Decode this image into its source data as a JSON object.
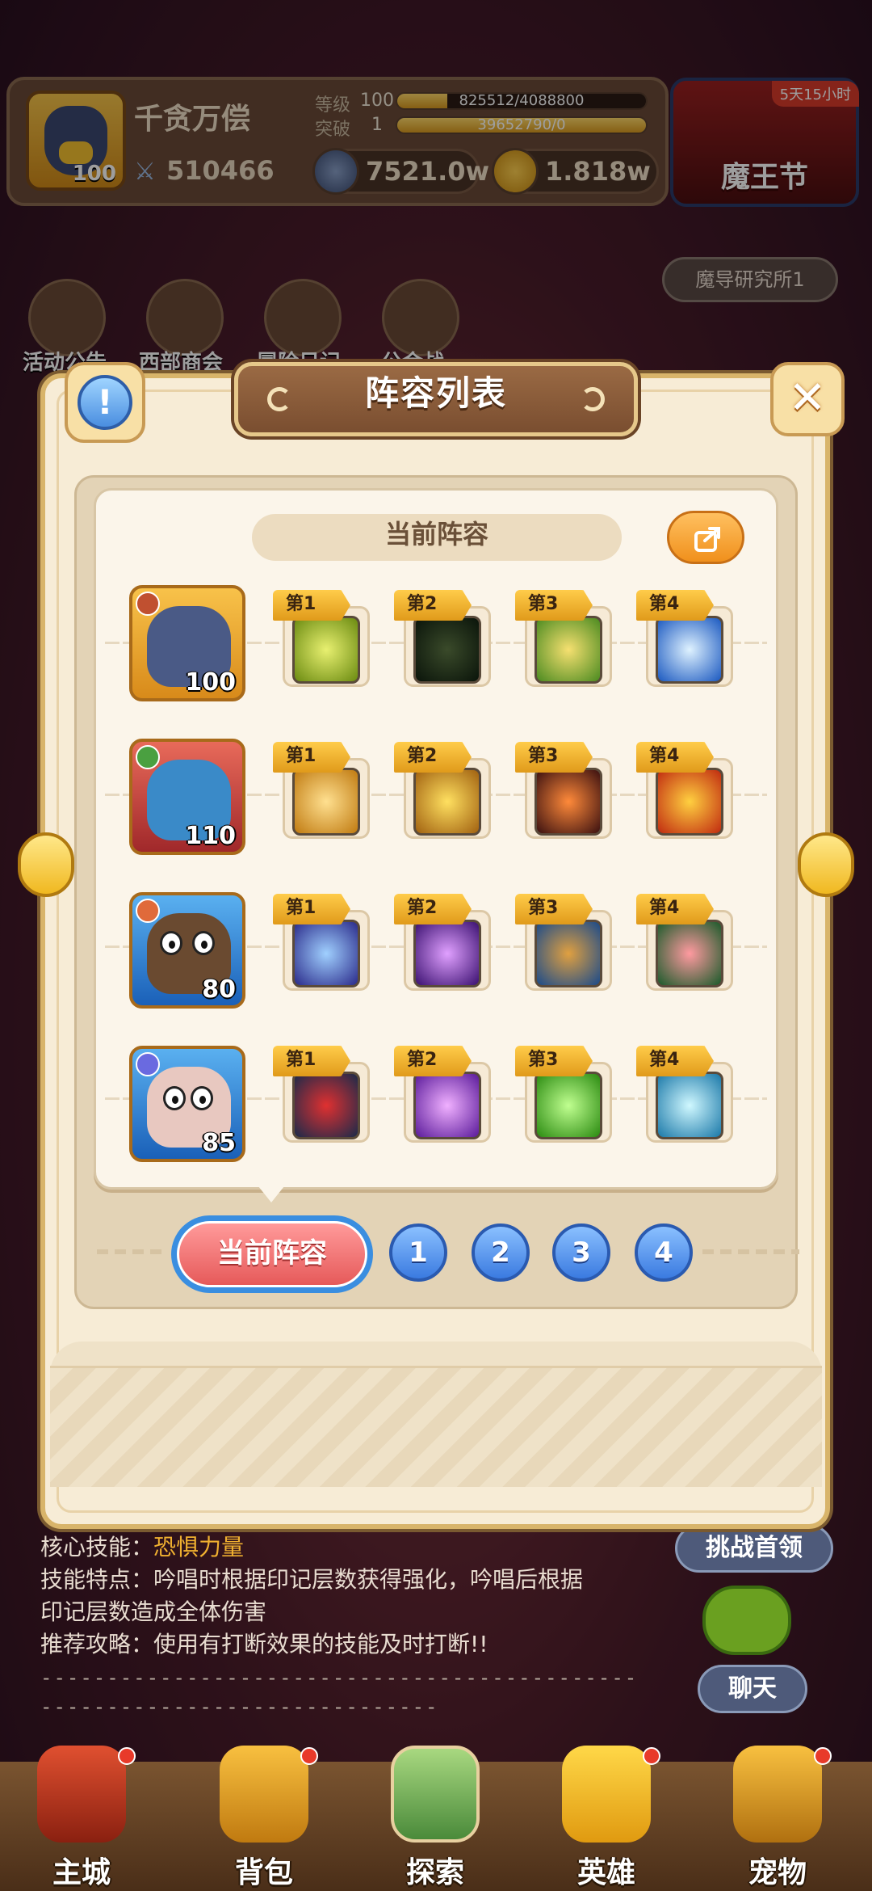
{
  "player": {
    "name": "千贪万偿",
    "level": "100",
    "power": "510466",
    "level_label": "等级",
    "level_value": "100",
    "exp": "825512/4088800",
    "break_label": "突破",
    "break_value": "1",
    "break_exp": "39652790/0",
    "currency1": "7521.0w",
    "currency2": "1.818w"
  },
  "event": {
    "title": "魔王节",
    "timer": "5天15小时"
  },
  "lab_button": "魔导研究所1",
  "menu": [
    {
      "label": "活动公告"
    },
    {
      "label": "西部商会"
    },
    {
      "label": "冒险日记"
    },
    {
      "label": "公会战"
    }
  ],
  "dialog": {
    "title": "阵容列表",
    "current_lineup_title": "当前阵容"
  },
  "heroes": [
    {
      "level": "100",
      "skills": [
        "第1",
        "第2",
        "第3",
        "第4"
      ]
    },
    {
      "level": "110",
      "skills": [
        "第1",
        "第2",
        "第3",
        "第4"
      ]
    },
    {
      "level": "80",
      "skills": [
        "第1",
        "第2",
        "第3",
        "第4"
      ]
    },
    {
      "level": "85",
      "skills": [
        "第1",
        "第2",
        "第3",
        "第4"
      ]
    }
  ],
  "tabs": {
    "current": "当前阵容",
    "numbers": [
      "1",
      "2",
      "3",
      "4"
    ]
  },
  "boss_info": {
    "core_skill_label": "核心技能：",
    "core_skill_value": "恐惧力量",
    "feature_label": "技能特点：",
    "feature_value": "吟唱时根据印记层数获得强化，吟唱后根据",
    "feature_value2": "印记层数造成全体伤害",
    "tip_label": "推荐攻略：",
    "tip_value": "使用有打断效果的技能及时打断!!",
    "dash1": "--------------------------------------------------",
    "dash2": "----------------------------------"
  },
  "side": {
    "challenge": "挑战首领",
    "chat": "聊天"
  },
  "nav": [
    "主城",
    "背包",
    "探索",
    "英雄",
    "宠物"
  ]
}
